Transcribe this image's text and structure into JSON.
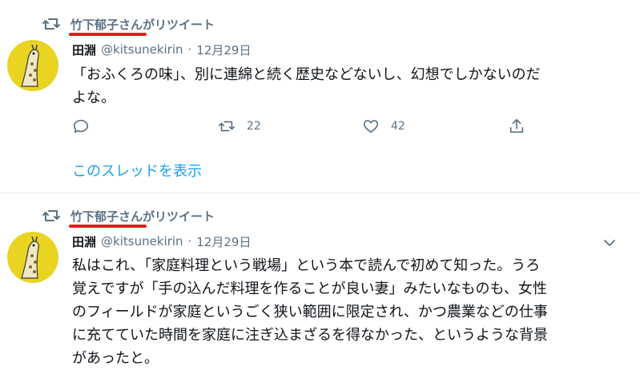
{
  "tweets": [
    {
      "retweeted_by": "竹下郁子さんがリツイート",
      "author_name": "田淵",
      "handle": "@kitsunekirin",
      "separator": "·",
      "date": "12月29日",
      "text": "「おふくろの味」、別に連綿と続く歴史などないし、幻想でしかないのだ\nよな。",
      "retweets": "22",
      "likes": "42",
      "show_thread": "このスレッドを表示"
    },
    {
      "retweeted_by": "竹下郁子さんがリツイート",
      "author_name": "田淵",
      "handle": "@kitsunekirin",
      "separator": "·",
      "date": "12月29日",
      "text": "私はこれ、「家庭料理という戦場」という本で読んで初めて知った。うろ\n覚えですが「手の込んだ料理を作ることが良い妻」みたいなものも、女性\nのフィールドが家庭というごく狭い範囲に限定され、かつ農業などの仕事\nに充てていた時間を家庭に注ぎ込まざるを得なかった、というような背景\nがあったと。"
    }
  ],
  "colors": {
    "muted": "#5b7083",
    "link": "#1da1f2",
    "underline": "#e41b1b",
    "avatar_bg": "#e8d421"
  },
  "icons": [
    "retweet-icon",
    "reply-icon",
    "like-icon",
    "share-icon",
    "caret-down-icon",
    "avatar-giraffe"
  ]
}
